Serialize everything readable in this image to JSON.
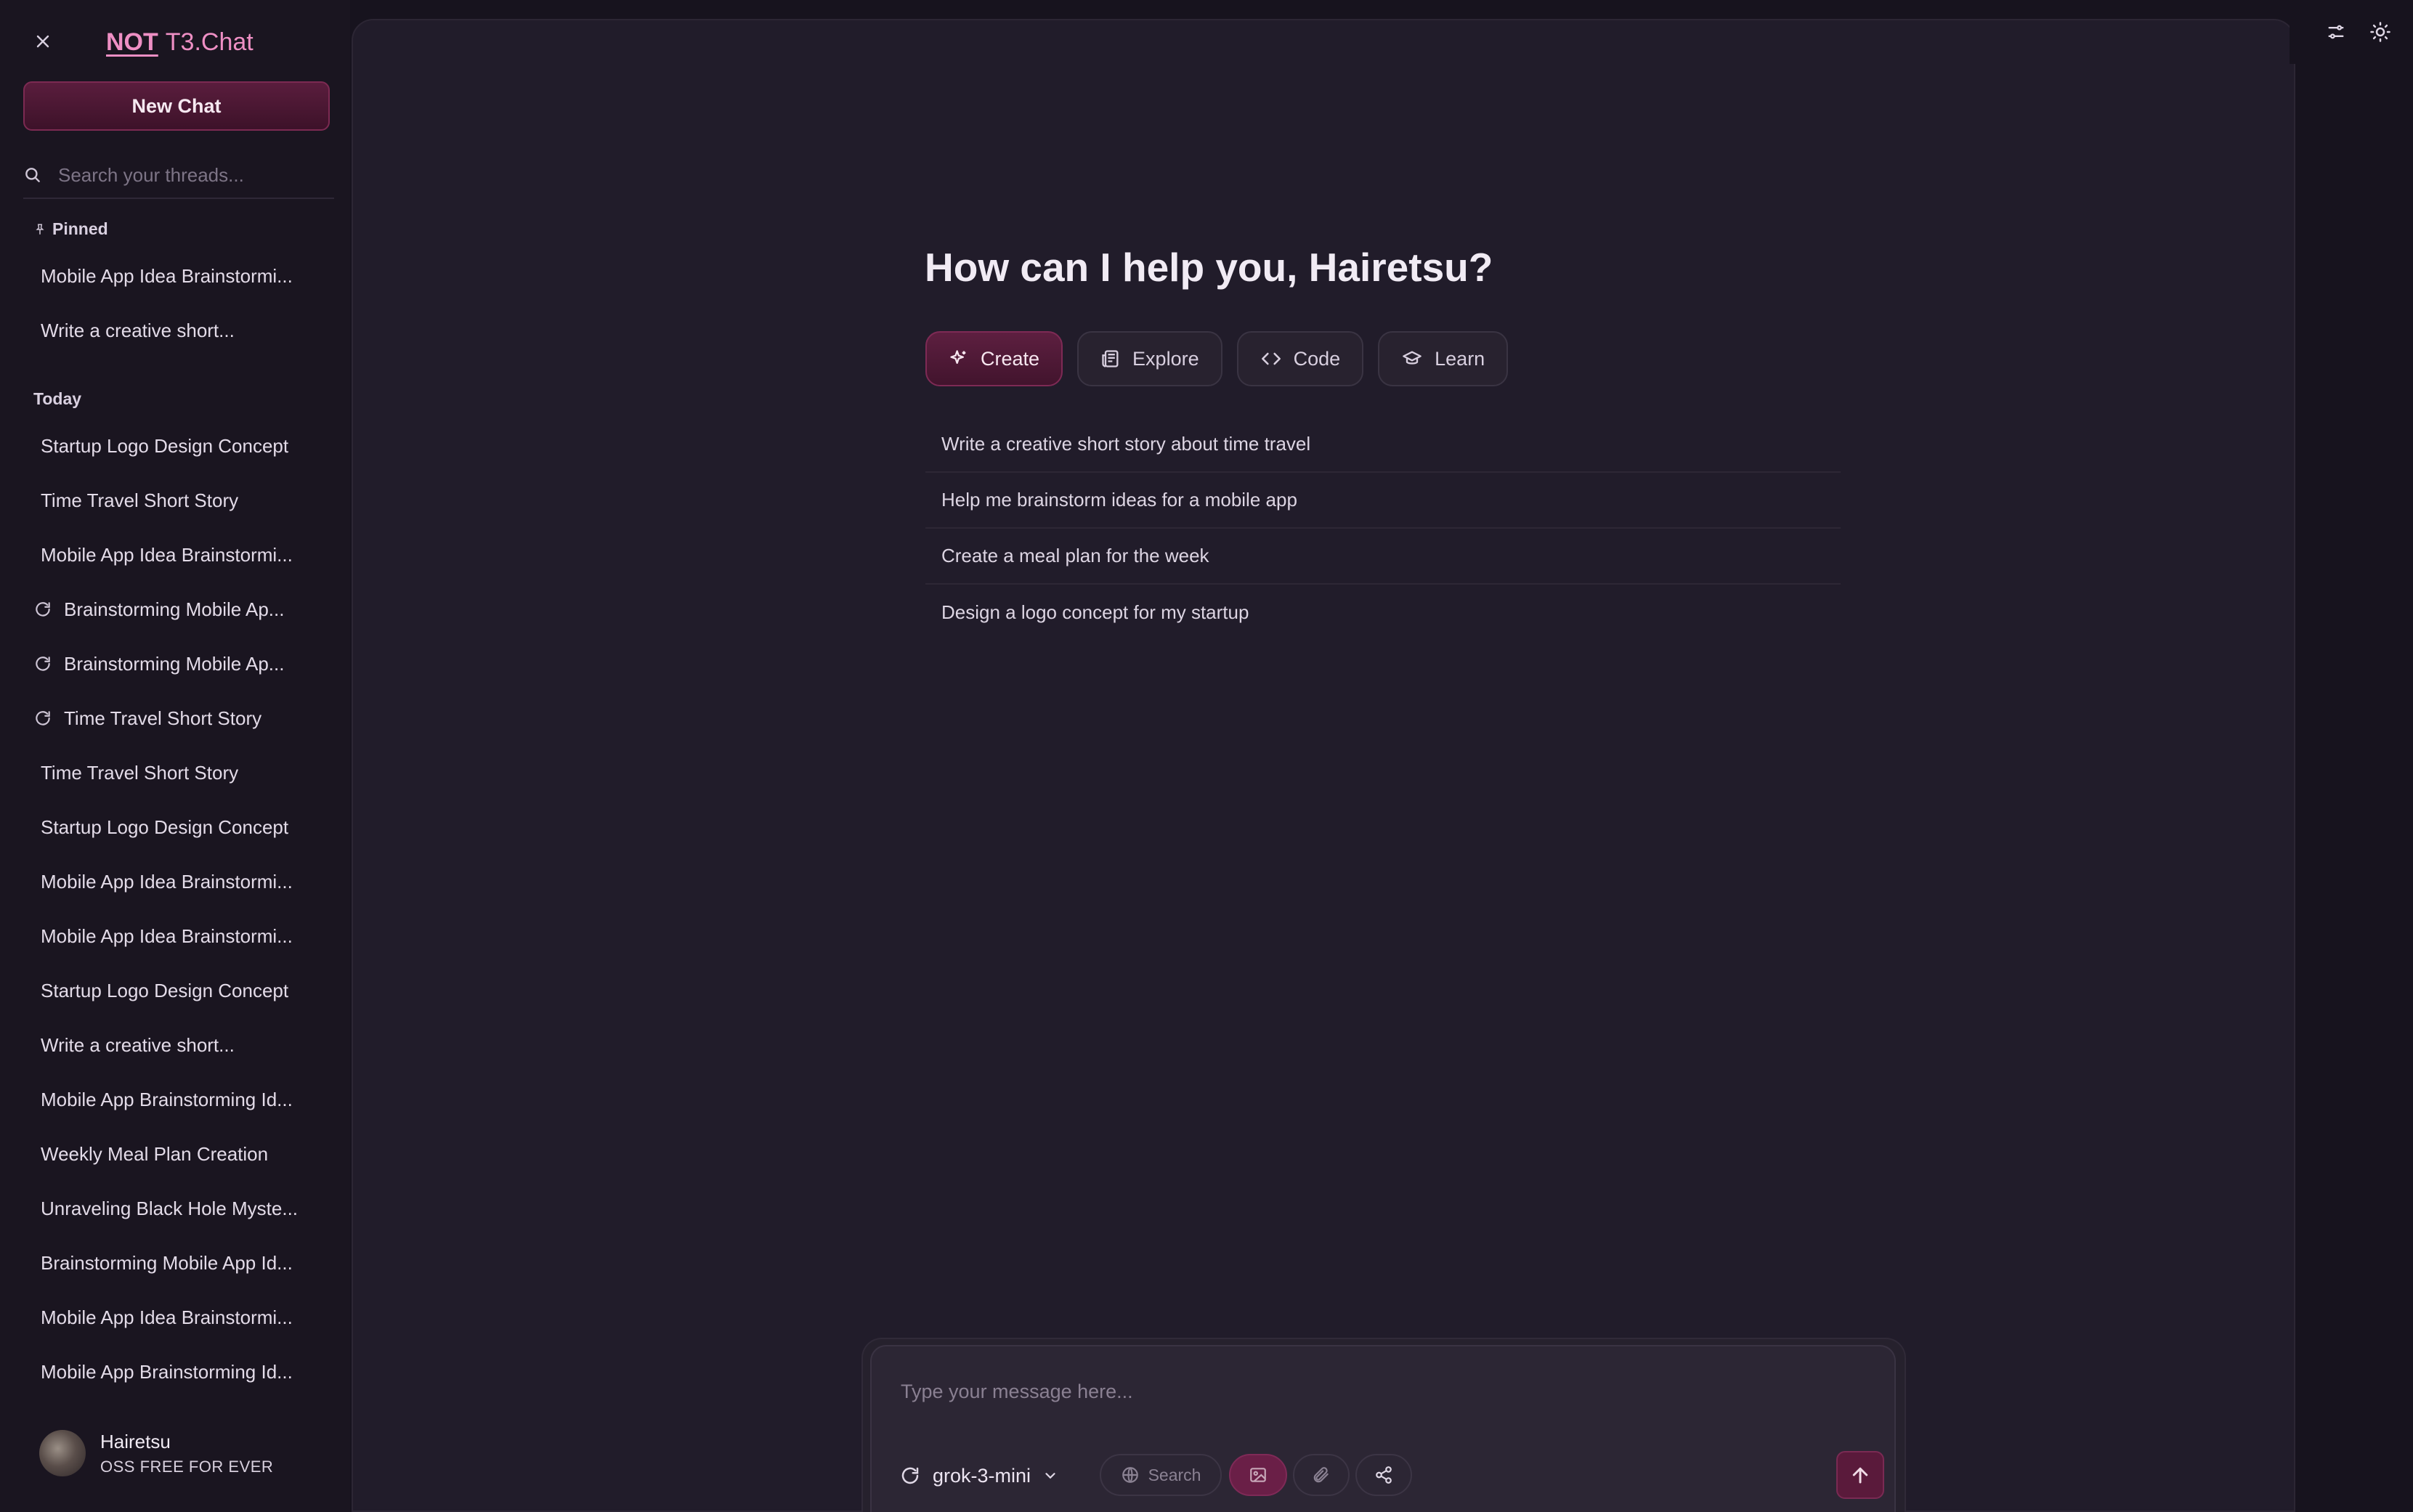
{
  "app": {
    "brand_not": "NOT",
    "brand_name": "T3.Chat"
  },
  "sidebar": {
    "new_chat_label": "New Chat",
    "search_placeholder": "Search your threads...",
    "pinned_label": "Pinned",
    "pinned": [
      {
        "label": "Mobile App Idea Brainstormi...",
        "branch": false
      },
      {
        "label": "Write a creative short...",
        "branch": false
      }
    ],
    "today_label": "Today",
    "today": [
      {
        "label": "Startup Logo Design Concept",
        "branch": false
      },
      {
        "label": "Time Travel Short Story",
        "branch": false
      },
      {
        "label": "Mobile App Idea Brainstormi...",
        "branch": false
      },
      {
        "label": "Brainstorming Mobile Ap...",
        "branch": true
      },
      {
        "label": "Brainstorming Mobile Ap...",
        "branch": true
      },
      {
        "label": "Time Travel Short Story",
        "branch": true
      },
      {
        "label": "Time Travel Short Story",
        "branch": false
      },
      {
        "label": "Startup Logo Design Concept",
        "branch": false
      },
      {
        "label": "Mobile App Idea Brainstormi...",
        "branch": false
      },
      {
        "label": "Mobile App Idea Brainstormi...",
        "branch": false
      },
      {
        "label": "Startup Logo Design Concept",
        "branch": false
      },
      {
        "label": "Write a creative short...",
        "branch": false
      },
      {
        "label": "Mobile App Brainstorming Id...",
        "branch": false
      },
      {
        "label": "Weekly Meal Plan Creation",
        "branch": false
      },
      {
        "label": "Unraveling Black Hole Myste...",
        "branch": false
      },
      {
        "label": "Brainstorming Mobile App Id...",
        "branch": false
      },
      {
        "label": "Mobile App Idea Brainstormi...",
        "branch": false
      },
      {
        "label": "Mobile App Brainstorming Id...",
        "branch": false
      }
    ],
    "user": {
      "name": "Hairetsu",
      "plan": "OSS FREE FOR EVER"
    }
  },
  "main": {
    "greeting": "How can I help you, Hairetsu?",
    "categories": [
      {
        "label": "Create",
        "icon": "sparkles-icon",
        "active": true
      },
      {
        "label": "Explore",
        "icon": "newspaper-icon",
        "active": false
      },
      {
        "label": "Code",
        "icon": "code-icon",
        "active": false
      },
      {
        "label": "Learn",
        "icon": "graduation-cap-icon",
        "active": false
      }
    ],
    "suggestions": [
      "Write a creative short story about time travel",
      "Help me brainstorm ideas for a mobile app",
      "Create a meal plan for the week",
      "Design a logo concept for my startup"
    ]
  },
  "composer": {
    "placeholder": "Type your message here...",
    "model": "grok-3-mini",
    "search_label": "Search"
  },
  "colors": {
    "accent": "#ee8fc4",
    "accent_dark": "#5a1d3d",
    "background": "#17131e",
    "panel": "#211c2a"
  }
}
